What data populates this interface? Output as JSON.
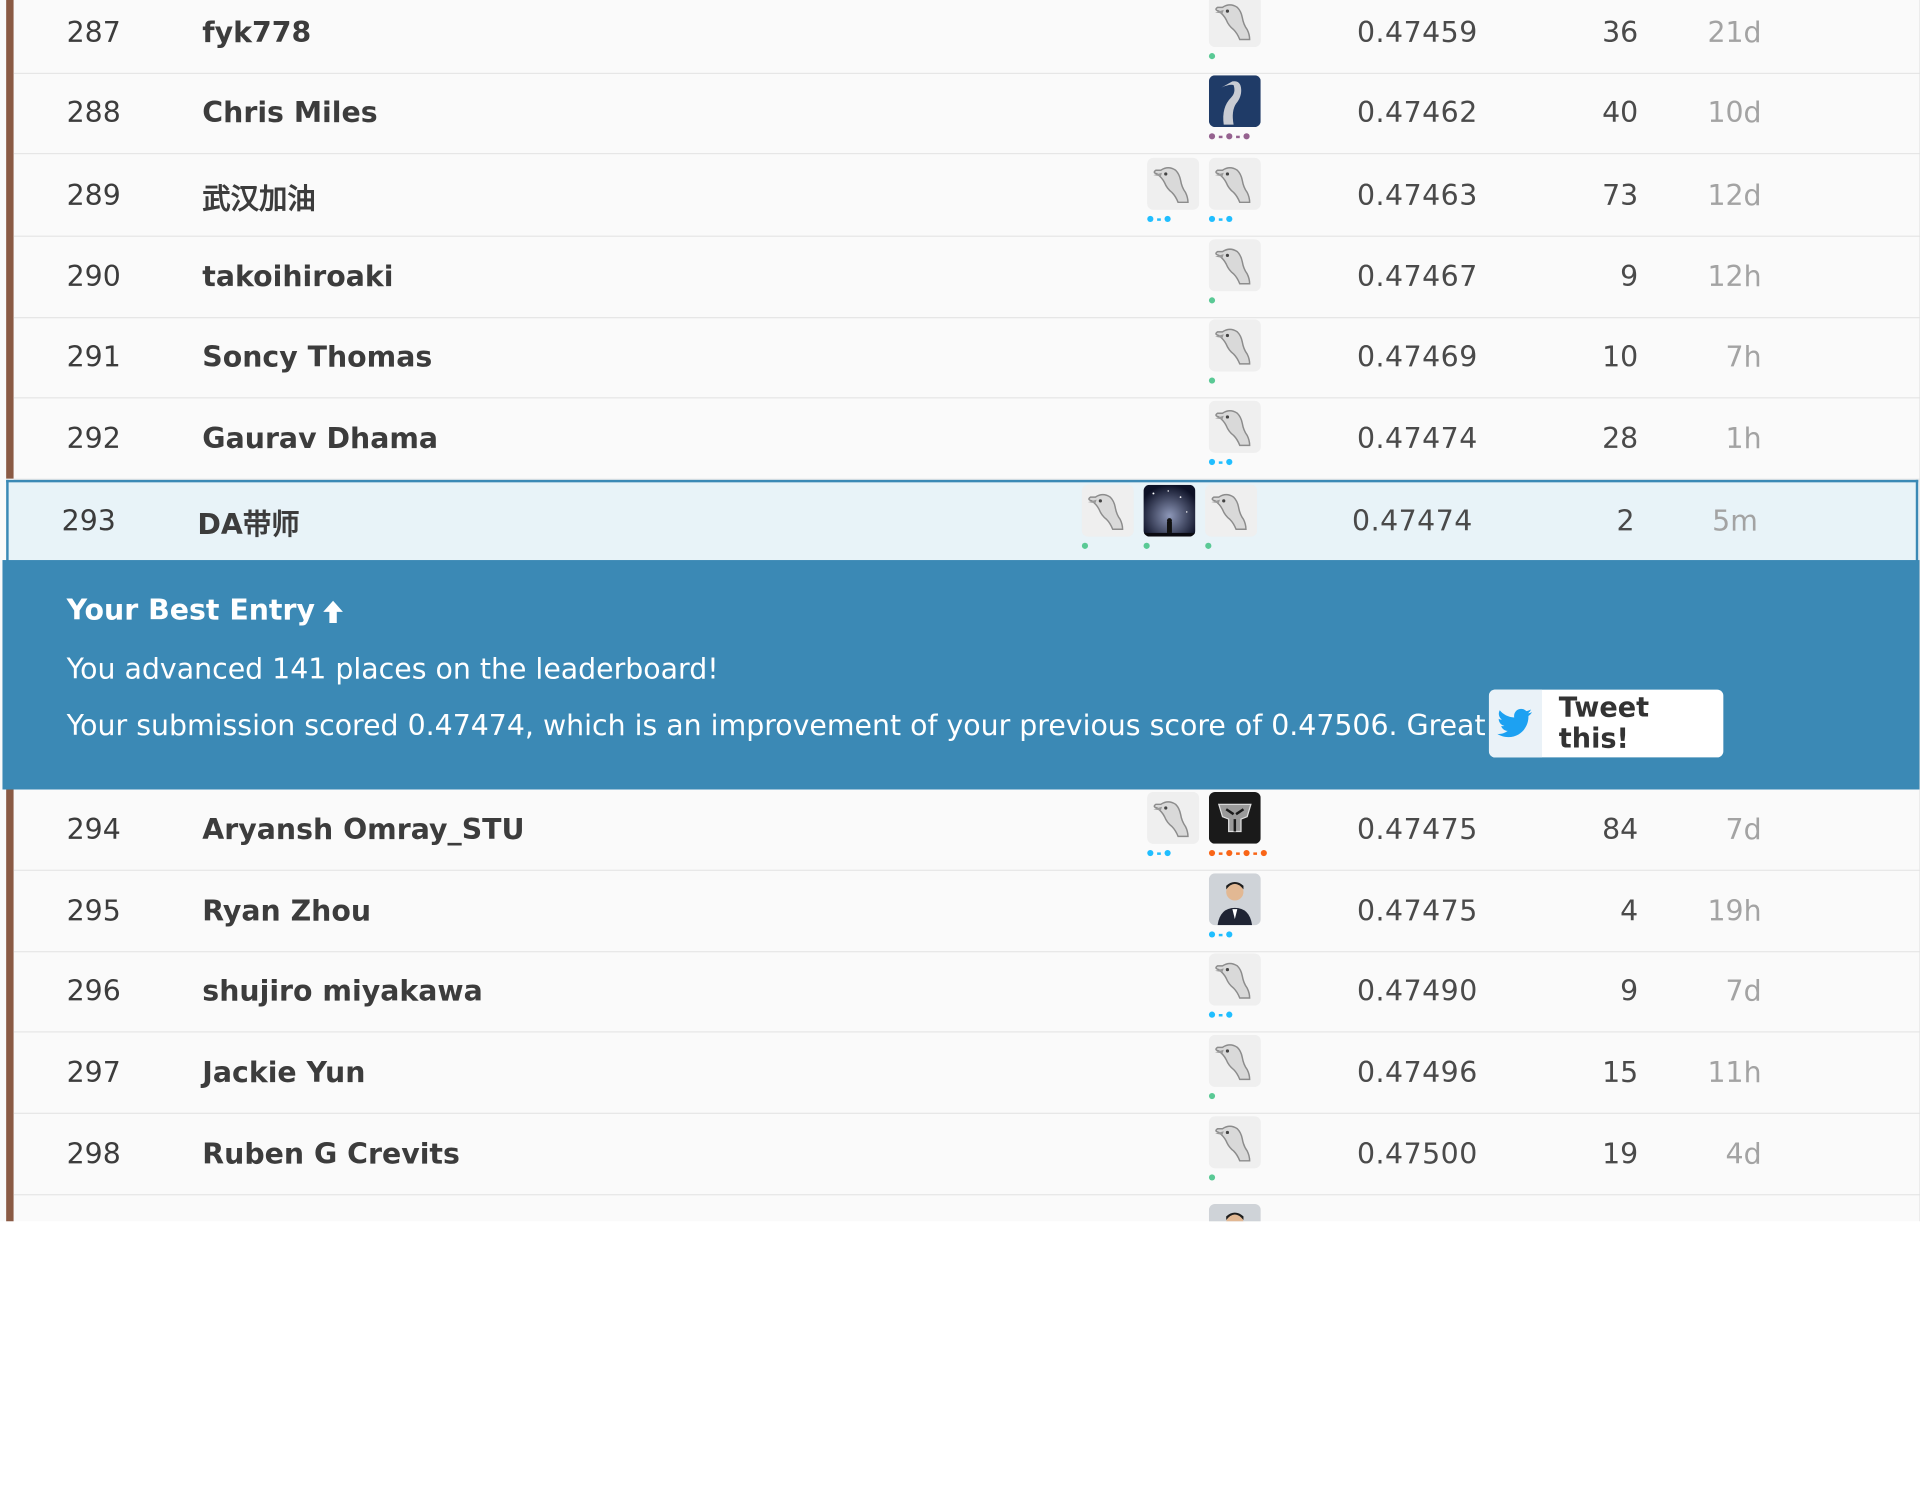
{
  "colors": {
    "accent": "#3b89b5",
    "stripe": "#8a5a44",
    "highlight_bg": "#e8f3f8"
  },
  "leaderboard": {
    "rows": [
      {
        "rank": "287",
        "name": "fyk778",
        "score": "0.47459",
        "entries": "36",
        "last": "21d",
        "team": [
          {
            "avatar": "kaggle-default-icon",
            "tier": "novice"
          }
        ]
      },
      {
        "rank": "288",
        "name": "Chris Miles",
        "score": "0.47462",
        "entries": "40",
        "last": "10d",
        "team": [
          {
            "avatar": "heron-photo-icon",
            "tier": "master"
          }
        ]
      },
      {
        "rank": "289",
        "name": "武汉加油",
        "score": "0.47463",
        "entries": "73",
        "last": "12d",
        "team": [
          {
            "avatar": "kaggle-default-icon",
            "tier": "contributor"
          },
          {
            "avatar": "kaggle-default-icon",
            "tier": "contributor"
          }
        ]
      },
      {
        "rank": "290",
        "name": "takoihiroaki",
        "score": "0.47467",
        "entries": "9",
        "last": "12h",
        "team": [
          {
            "avatar": "kaggle-default-icon",
            "tier": "novice"
          }
        ]
      },
      {
        "rank": "291",
        "name": "Soncy Thomas",
        "score": "0.47469",
        "entries": "10",
        "last": "7h",
        "team": [
          {
            "avatar": "kaggle-default-icon",
            "tier": "novice"
          }
        ]
      },
      {
        "rank": "292",
        "name": "Gaurav Dhama",
        "score": "0.47474",
        "entries": "28",
        "last": "1h",
        "team": [
          {
            "avatar": "kaggle-default-icon",
            "tier": "contributor"
          }
        ]
      },
      {
        "rank": "293",
        "name": "DA带师",
        "score": "0.47474",
        "entries": "2",
        "last": "5m",
        "self": true,
        "team": [
          {
            "avatar": "kaggle-default-icon",
            "tier": "novice"
          },
          {
            "avatar": "starry-sky-photo-icon",
            "tier": "novice"
          },
          {
            "avatar": "kaggle-default-icon",
            "tier": "novice"
          }
        ]
      },
      {
        "rank": "294",
        "name": "Aryansh Omray_STU",
        "score": "0.47475",
        "entries": "84",
        "last": "7d",
        "team": [
          {
            "avatar": "kaggle-default-icon",
            "tier": "contributor"
          },
          {
            "avatar": "transformers-logo-icon",
            "tier": "grandmaster"
          }
        ]
      },
      {
        "rank": "295",
        "name": "Ryan Zhou",
        "score": "0.47475",
        "entries": "4",
        "last": "19h",
        "team": [
          {
            "avatar": "person-portrait-icon",
            "tier": "contributor"
          }
        ]
      },
      {
        "rank": "296",
        "name": "shujiro miyakawa",
        "score": "0.47490",
        "entries": "9",
        "last": "7d",
        "team": [
          {
            "avatar": "kaggle-default-icon",
            "tier": "contributor"
          }
        ]
      },
      {
        "rank": "297",
        "name": "Jackie Yun",
        "score": "0.47496",
        "entries": "15",
        "last": "11h",
        "team": [
          {
            "avatar": "kaggle-default-icon",
            "tier": "novice"
          }
        ]
      },
      {
        "rank": "298",
        "name": "Ruben G Crevits",
        "score": "0.47500",
        "entries": "19",
        "last": "4d",
        "team": [
          {
            "avatar": "kaggle-default-icon",
            "tier": "novice"
          }
        ]
      }
    ],
    "partial_row": {
      "team": [
        {
          "avatar": "person-portrait-icon"
        }
      ]
    }
  },
  "banner": {
    "title": "Your Best Entry",
    "title_icon": "arrow-up-icon",
    "line1": "You advanced 141 places on the leaderboard!",
    "line2": "Your submission scored 0.47474, which is an improvement of your previous score of 0.47506. Great job!",
    "tweet_label": "Tweet this!",
    "tweet_icon": "twitter-bird-icon"
  }
}
